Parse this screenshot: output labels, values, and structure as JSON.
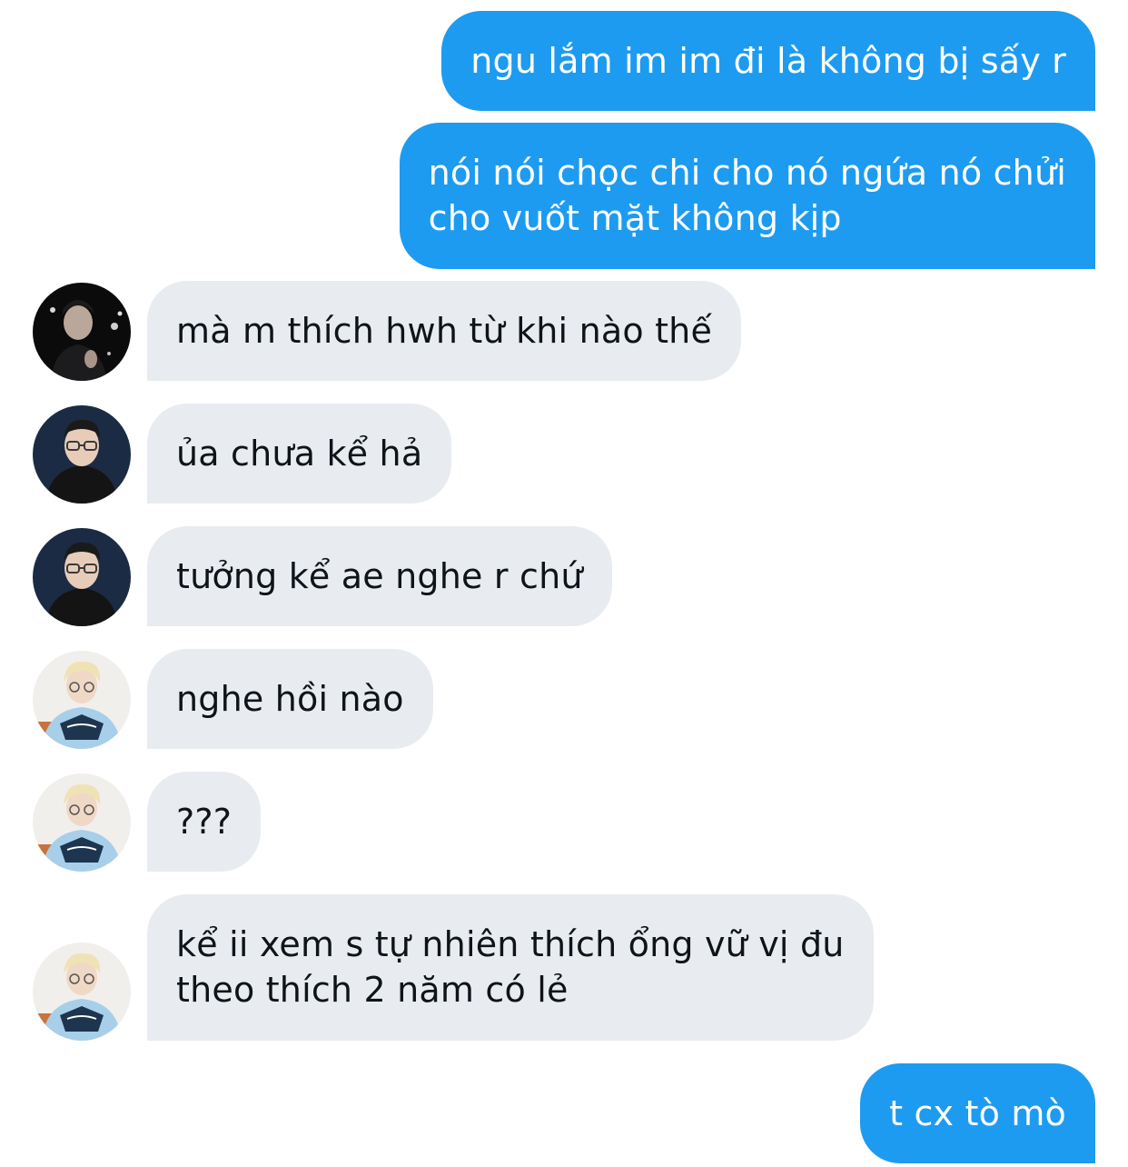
{
  "conversation": {
    "messages": [
      {
        "direction": "out",
        "text": "ngu lắm im im đi là không bị sấy r"
      },
      {
        "direction": "out",
        "lines": [
          "nói nói chọc chi cho nó ngứa nó chửi",
          "cho vuốt mặt không kịp"
        ]
      },
      {
        "direction": "in",
        "avatar": "avatar-dark-photo",
        "text": "mà m thích hwh từ khi nào thế"
      },
      {
        "direction": "in",
        "avatar": "avatar-glasses-hoodie",
        "text": "ủa chưa kể hả"
      },
      {
        "direction": "in",
        "avatar": "avatar-glasses-hoodie",
        "text": "tưởng kể ae nghe r chứ"
      },
      {
        "direction": "in",
        "avatar": "avatar-blonde-jersey",
        "text": "nghe hồi nào"
      },
      {
        "direction": "in",
        "avatar": "avatar-blonde-jersey",
        "text": "???"
      },
      {
        "direction": "in",
        "avatar": "avatar-blonde-jersey",
        "lines": [
          "kể ii xem s tự nhiên thích ổng vữ vị đu",
          "theo thích 2 năm có lẻ"
        ]
      },
      {
        "direction": "out",
        "text": "t cx tò mò"
      }
    ]
  },
  "colors": {
    "outgoing_bubble": "#1d9bf0",
    "incoming_bubble": "#e8ecf0",
    "incoming_text": "#0f1419",
    "outgoing_text": "#ffffff"
  }
}
